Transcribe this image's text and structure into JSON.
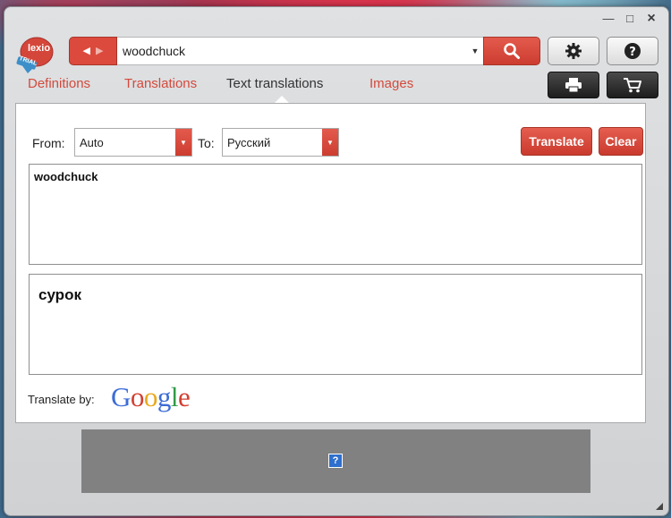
{
  "window": {
    "controls": {
      "minimize": "—",
      "maximize": "□",
      "close": "×"
    }
  },
  "logo": {
    "text": "lexio",
    "badge": "TRIAL"
  },
  "search": {
    "query": "woodchuck",
    "back_icon": "left-arrow-icon",
    "forward_icon": "right-arrow-icon",
    "dropdown_icon": "caret-down-icon",
    "search_icon": "magnifier-icon"
  },
  "toolbar": {
    "settings_icon": "gear-icon",
    "help_icon": "question-icon",
    "print_icon": "printer-icon",
    "cart_icon": "cart-icon"
  },
  "tabs": [
    {
      "label": "Definitions",
      "active": false
    },
    {
      "label": "Translations",
      "active": false
    },
    {
      "label": "Text translations",
      "active": true
    },
    {
      "label": "Images",
      "active": false
    }
  ],
  "translation": {
    "from_label": "From:",
    "from_value": "Auto",
    "to_label": "To:",
    "to_value": "Русский",
    "translate_button": "Translate",
    "clear_button": "Clear",
    "source_text": "woodchuck",
    "result_text": "сурок",
    "translate_by_label": "Translate by:",
    "provider": "Google"
  },
  "ad": {
    "placeholder_icon": "?"
  },
  "colors": {
    "accent_red": "#d34a3c",
    "google_blue": "#3c6cd6",
    "google_red": "#d23f31",
    "google_yellow": "#e8a91a",
    "google_green": "#2f9a47"
  }
}
